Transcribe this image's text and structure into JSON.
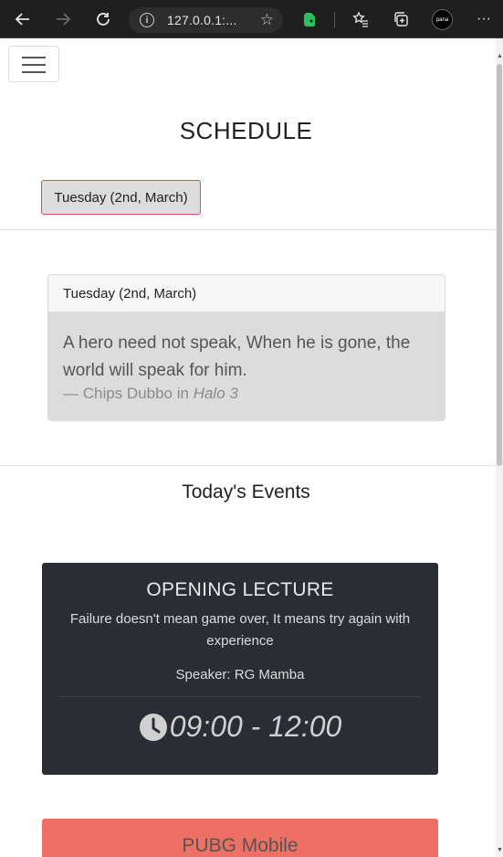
{
  "browser": {
    "url": "127.0.0.1:...",
    "profile_label": "pana",
    "icons": [
      "back-icon",
      "forward-icon",
      "reload-icon",
      "info-icon",
      "favorite-add-icon",
      "evernote-icon",
      "favorites-icon",
      "collections-icon",
      "profile-avatar",
      "more-icon"
    ]
  },
  "page": {
    "title": "SCHEDULE",
    "day_button": "Tuesday (2nd, March)",
    "quote_card": {
      "header": "Tuesday (2nd, March)",
      "quote": "A hero need not speak, When he is gone, the world will speak for him.",
      "cite_prefix": "— Chips Dubbo in ",
      "cite_source": "Halo 3"
    },
    "events_title": "Today's Events",
    "events": [
      {
        "title": "OPENING LECTURE",
        "description": "Failure doesn't mean game over, It means try again with experience",
        "speaker": "Speaker: RG Mamba",
        "time": "09:00 - 12:00"
      },
      {
        "title": "PUBG Mobile"
      }
    ]
  },
  "colors": {
    "event_dark_bg": "#2a2d34",
    "event_red_bg": "#ee7065",
    "day_button_border": "#d9534f"
  }
}
